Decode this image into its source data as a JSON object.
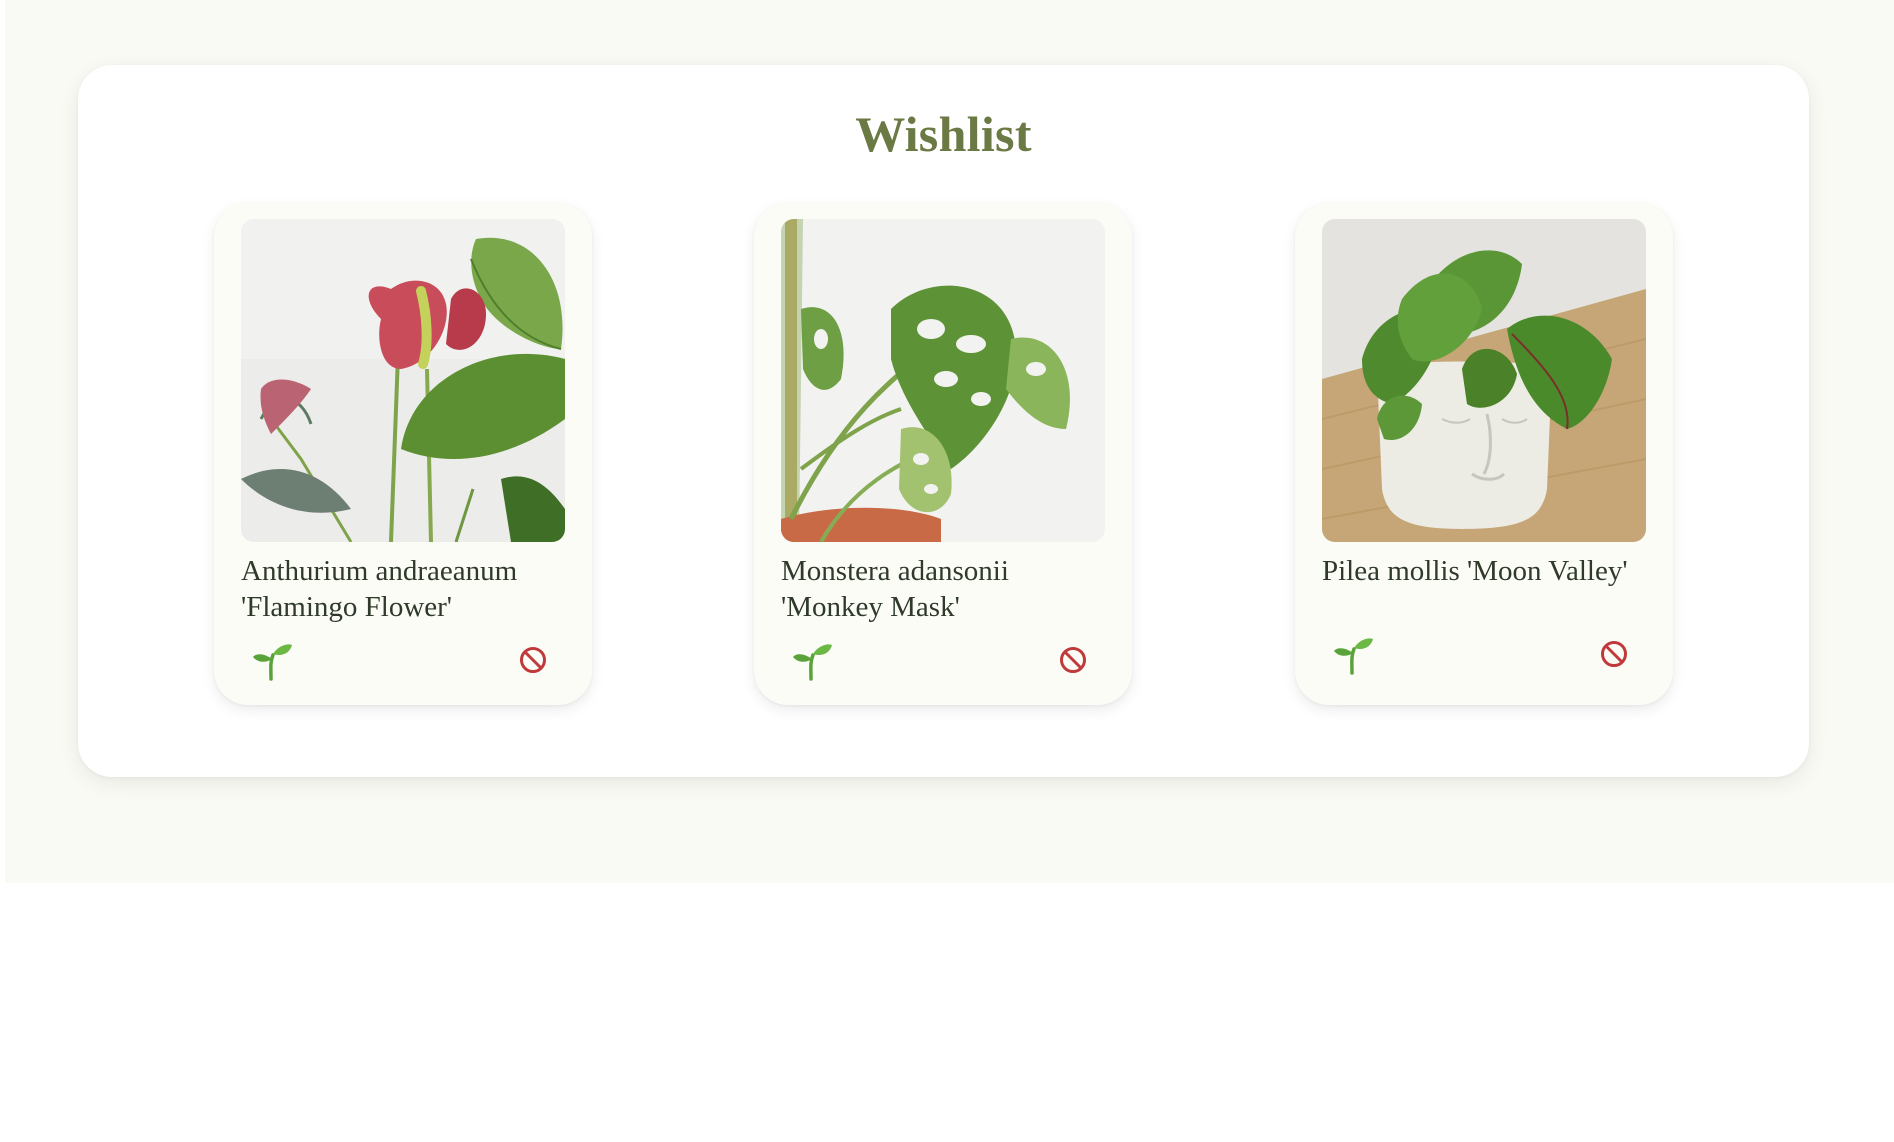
{
  "wishlist": {
    "title": "Wishlist",
    "plants": [
      {
        "name": "Anthurium andraeanum 'Flamingo Flower'",
        "photo_icon": "anthurium-photo",
        "action_icons": [
          "sprout-icon",
          "no-entry-icon"
        ]
      },
      {
        "name": "Monstera adansonii 'Monkey Mask'",
        "photo_icon": "monstera-photo",
        "action_icons": [
          "sprout-icon",
          "no-entry-icon"
        ]
      },
      {
        "name": "Pilea mollis 'Moon Valley'",
        "photo_icon": "pilea-photo",
        "action_icons": [
          "sprout-icon",
          "no-entry-icon"
        ]
      }
    ]
  },
  "colors": {
    "page_background": "#f9faf4",
    "panel_background": "#ffffff",
    "card_background": "#fbfcf6",
    "title": "#6b7a44",
    "text": "#2f3a2b",
    "sprout": "#5aa33a",
    "no_entry": "#c0393b"
  }
}
